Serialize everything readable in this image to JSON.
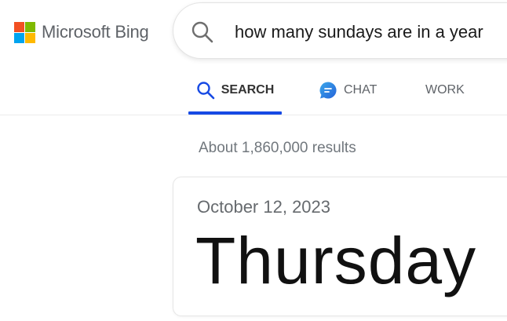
{
  "brand": {
    "name": "Microsoft Bing",
    "logo_colors": [
      "#f25022",
      "#7fba00",
      "#00a4ef",
      "#ffb900"
    ]
  },
  "search": {
    "query": "how many sundays are in a year",
    "icon": "search-icon"
  },
  "tabs": [
    {
      "label": "SEARCH",
      "icon": "search-icon",
      "active": true
    },
    {
      "label": "CHAT",
      "icon": "chat-icon",
      "active": false
    },
    {
      "label": "WORK",
      "icon": null,
      "active": false
    }
  ],
  "results": {
    "count_text": "About 1,860,000 results"
  },
  "answer": {
    "date": "October 12, 2023",
    "day": "Thursday"
  },
  "colors": {
    "accent": "#174ae4"
  }
}
